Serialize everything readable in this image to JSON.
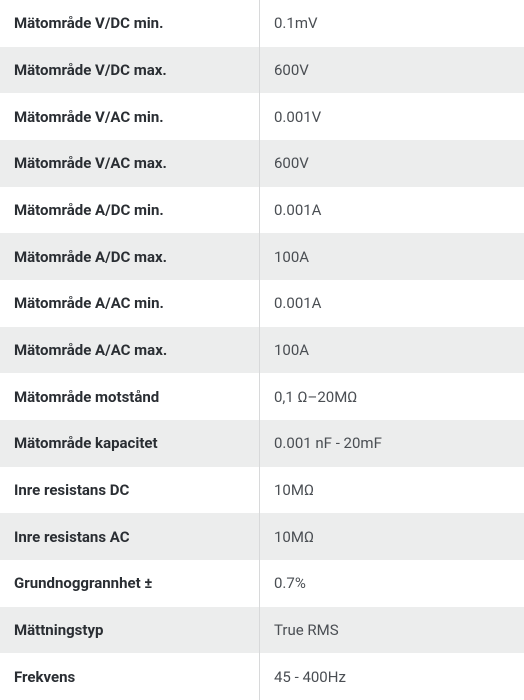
{
  "specs": [
    {
      "label": "Mätområde V/DC min.",
      "value": "0.1mV"
    },
    {
      "label": "Mätområde V/DC max.",
      "value": "600V"
    },
    {
      "label": "Mätområde V/AC min.",
      "value": "0.001V"
    },
    {
      "label": "Mätområde V/AC max.",
      "value": "600V"
    },
    {
      "label": "Mätområde A/DC min.",
      "value": "0.001A"
    },
    {
      "label": "Mätområde A/DC max.",
      "value": "100A"
    },
    {
      "label": "Mätområde A/AC min.",
      "value": "0.001A"
    },
    {
      "label": "Mätområde A/AC max.",
      "value": "100A"
    },
    {
      "label": "Mätområde motstånd",
      "value": "0,1 Ω–20MΩ"
    },
    {
      "label": "Mätområde kapacitet",
      "value": "0.001 nF - 20mF"
    },
    {
      "label": "Inre resistans DC",
      "value": "10MΩ"
    },
    {
      "label": "Inre resistans AC",
      "value": "10MΩ"
    },
    {
      "label": "Grundnoggrannhet ±",
      "value": "0.7%"
    },
    {
      "label": "Mättningstyp",
      "value": "True RMS"
    },
    {
      "label": "Frekvens",
      "value": "45 - 400Hz"
    }
  ]
}
